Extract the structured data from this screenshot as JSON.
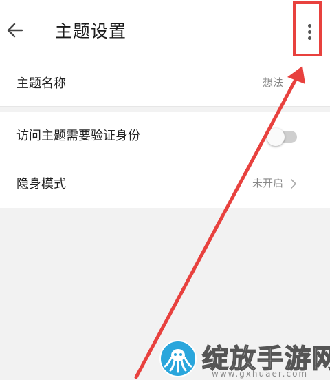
{
  "header": {
    "title": "主题设置",
    "back_icon": "arrow-left-icon",
    "more_icon": "more-vertical-icon"
  },
  "settings": {
    "theme_name": {
      "label": "主题名称",
      "value": "想法"
    },
    "verify_identity": {
      "label": "访问主题需要验证身份",
      "enabled": false
    },
    "stealth_mode": {
      "label": "隐身模式",
      "value": "未开启"
    }
  },
  "annotation": {
    "color": "#e8413e"
  },
  "watermark": {
    "text": "绽放手游网",
    "url": "www.gxhuaer.com"
  }
}
